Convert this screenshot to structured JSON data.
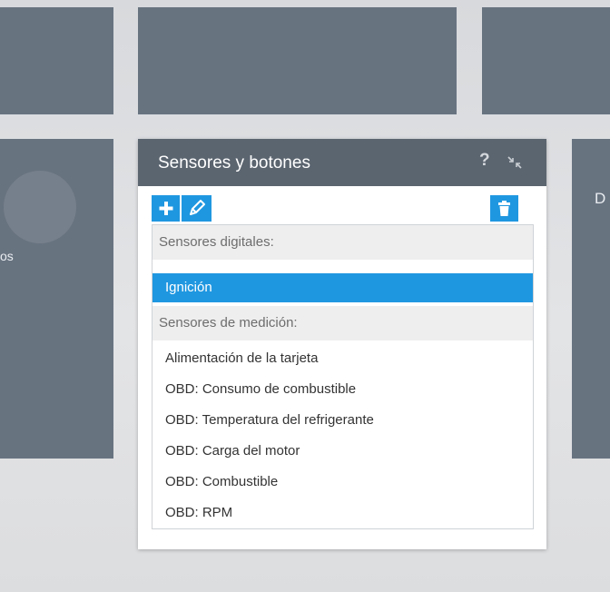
{
  "background_tiles": {
    "left_text_fragment": "os",
    "right_text_fragment": "D e"
  },
  "widget": {
    "title": "Sensores y botones",
    "help_label": "?",
    "toolbar": {
      "add_icon": "plus-icon",
      "edit_icon": "pencil-icon",
      "delete_icon": "trash-icon"
    },
    "sections": [
      {
        "header": "Sensores digitales:",
        "items": [
          "Ignición"
        ]
      },
      {
        "header": "Sensores de medición:",
        "items": [
          "Alimentación de la tarjeta",
          "OBD: Consumo de combustible",
          "OBD: Temperatura del refrigerante",
          "OBD: Carga del motor",
          "OBD: Combustible",
          "OBD: RPM"
        ]
      }
    ],
    "selected_item": "Ignición"
  },
  "colors": {
    "accent": "#1f97e0",
    "header_bg": "#5b6570",
    "tile_bg": "#687380"
  }
}
